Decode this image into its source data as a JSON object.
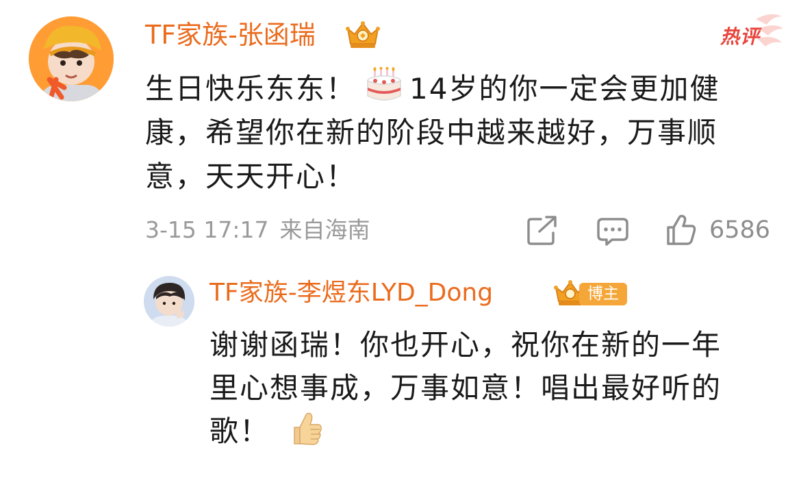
{
  "hot_tag": "热评",
  "main_comment": {
    "author": "TF家族-张函瑞",
    "text_lines": [
      "生日快乐东东！",
      "14岁的你一定会更加健",
      "康，希望你在新的阶段中越来越好，万事顺",
      "意，天天开心！"
    ],
    "emoji": "cake-icon",
    "date": "3-15 17:17",
    "location": "来自海南",
    "likes": "6586"
  },
  "reply": {
    "author": "TF家族-李煜东LYD_Dong",
    "badge": "博主",
    "text_lines": [
      "谢谢函瑞！你也开心，祝你在新的一年",
      "里心想事成，万事如意！唱出最好听的",
      "歌！"
    ],
    "emoji": "thumbs-up-icon"
  },
  "colors": {
    "name": "#eb6b1d",
    "hot": "#e8453c",
    "meta": "#9a9a9a",
    "badge": "#f5a638"
  }
}
